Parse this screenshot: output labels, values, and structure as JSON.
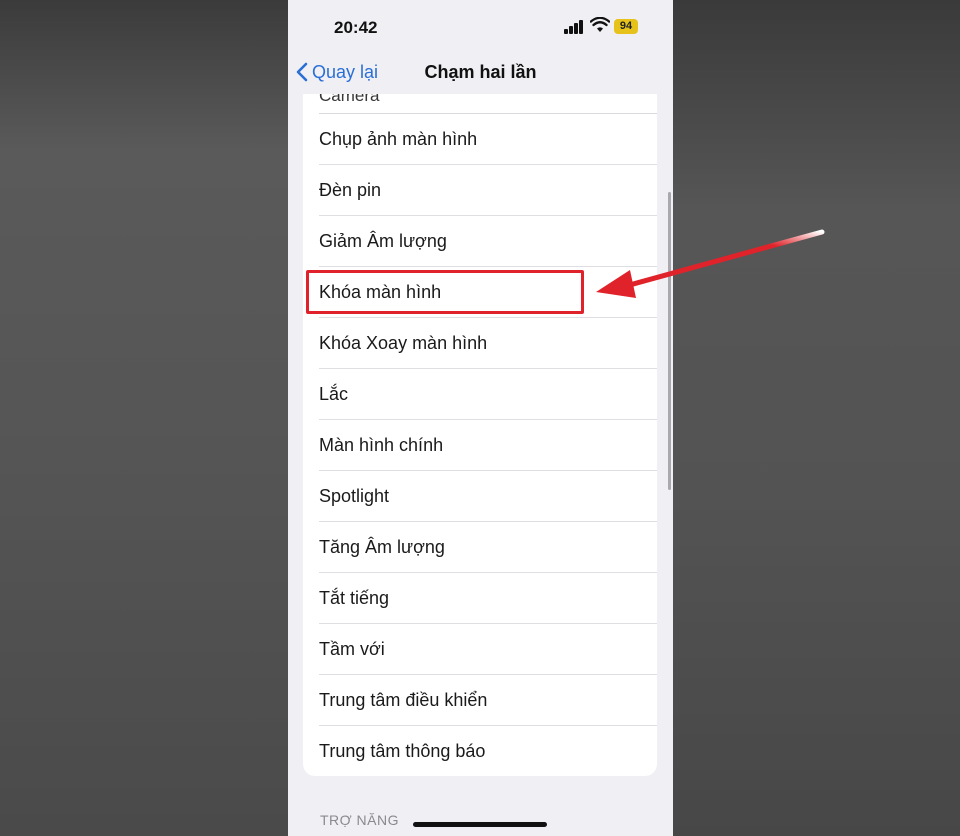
{
  "status_bar": {
    "time": "20:42",
    "battery": "94",
    "battery_color": "#e6c21a"
  },
  "nav": {
    "back_label": "Quay lại",
    "title": "Chạm hai lần"
  },
  "list": {
    "partial_top_item": "Camera",
    "items": [
      {
        "label": "Chụp ảnh màn hình"
      },
      {
        "label": "Đèn pin"
      },
      {
        "label": "Giảm Âm lượng"
      },
      {
        "label": "Khóa màn hình",
        "highlighted": true
      },
      {
        "label": "Khóa Xoay màn hình"
      },
      {
        "label": "Lắc"
      },
      {
        "label": "Màn hình chính"
      },
      {
        "label": "Spotlight"
      },
      {
        "label": "Tăng Âm lượng"
      },
      {
        "label": "Tắt tiếng"
      },
      {
        "label": "Tầm với"
      },
      {
        "label": "Trung tâm điều khiển"
      },
      {
        "label": "Trung tâm thông báo"
      }
    ]
  },
  "section_header": "TRỢ NĂNG",
  "annotation": {
    "color": "#e0232a"
  },
  "icons": {
    "back": "chevron-left-icon",
    "wifi": "wifi-icon",
    "signal": "cellular-signal-icon",
    "battery": "battery-icon"
  }
}
